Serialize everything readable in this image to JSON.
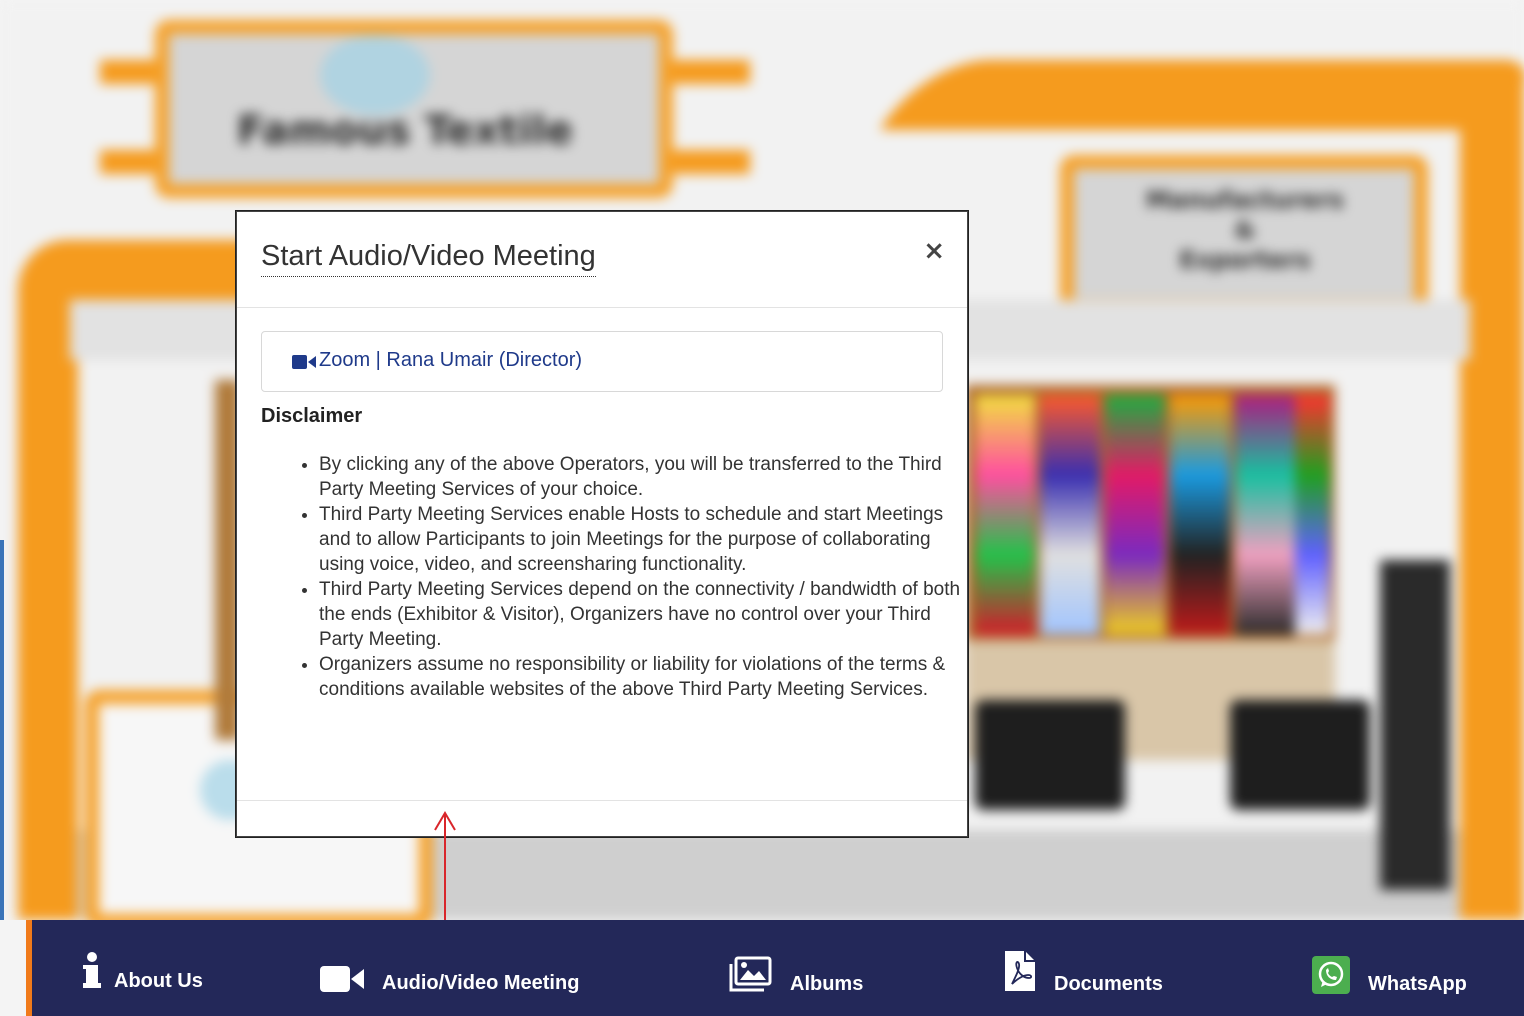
{
  "modal": {
    "title": "Start Audio/Video Meeting",
    "close_symbol": "×",
    "operator": {
      "icon": "video-camera-icon",
      "label": "Zoom | Rana Umair (Director)"
    },
    "disclaimer_title": "Disclaimer",
    "disclaimer_items": [
      "By clicking any of the above Operators, you will be transferred to the Third Party Meeting Services of your choice.",
      "Third Party Meeting Services enable Hosts to schedule and start Meetings and to allow Participants to join Meetings for the purpose of collaborating using voice, video, and screensharing functionality.",
      "Third Party Meeting Services depend on the connectivity / bandwidth of both the ends (Exhibitor & Visitor), Organizers have no control over your Third Party Meeting.",
      "Organizers assume no responsibility or liability for violations of the terms & conditions available websites of the above Third Party Meeting Services."
    ]
  },
  "navbar": {
    "items": [
      {
        "label": "About Us",
        "icon": "info-icon"
      },
      {
        "label": "Audio/Video Meeting",
        "icon": "video-camera-icon"
      },
      {
        "label": "Albums",
        "icon": "image-gallery-icon"
      },
      {
        "label": "Documents",
        "icon": "pdf-document-icon"
      },
      {
        "label": "WhatsApp",
        "icon": "whatsapp-icon"
      }
    ]
  },
  "colors": {
    "navbar_bg": "#232859",
    "navbar_accent": "#f07a1a",
    "booth_orange": "#f59b1e",
    "operator_text": "#1f3a8a",
    "whatsapp_green": "#4cae4f",
    "annotation_arrow": "#d9262b"
  }
}
